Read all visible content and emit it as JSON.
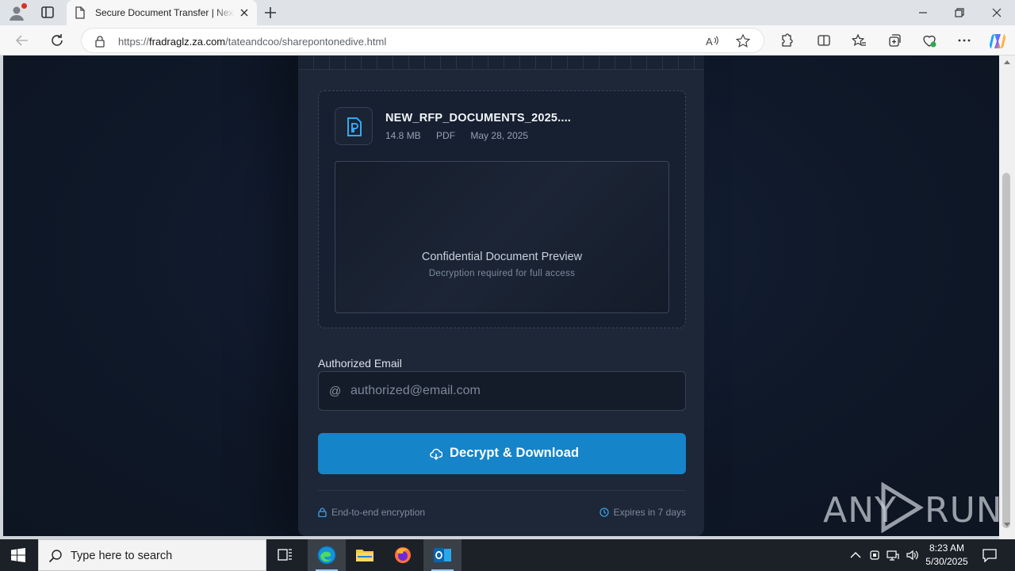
{
  "browser": {
    "tab_title": "Secure Document Transfer | Nexo",
    "url_prefix": "https://",
    "url_domain": "fradraglz.za.com",
    "url_path": "/tateandcoo/sharepontonedive.html"
  },
  "file": {
    "name": "NEW_RFP_DOCUMENTS_2025....",
    "size": "14.8 MB",
    "type": "PDF",
    "date": "May 28, 2025"
  },
  "preview": {
    "title": "Confidential Document Preview",
    "subtitle": "Decryption required for full access"
  },
  "form": {
    "email_label": "Authorized Email",
    "at_symbol": "@",
    "email_placeholder": "authorized@email.com",
    "email_value": "",
    "submit_label": "Decrypt & Download"
  },
  "footer": {
    "left": "End-to-end encryption",
    "right": "Expires in 7 days"
  },
  "watermark": {
    "left": "ANY",
    "right": "RUN"
  },
  "taskbar": {
    "search_placeholder": "Type here to search",
    "time": "8:23 AM",
    "date": "5/30/2025"
  },
  "colors": {
    "accent": "#1584c9",
    "page_bg": "#0f1724",
    "card_bg": "#1d2737",
    "file_icon": "#35a7f2"
  },
  "icons": [
    "profile-icon",
    "tab-actions-icon",
    "document-icon",
    "close-icon",
    "plus-icon",
    "minimize-icon",
    "restore-icon",
    "back-arrow-icon",
    "refresh-icon",
    "lock-icon",
    "read-aloud-icon",
    "star-icon",
    "extensions-icon",
    "split-screen-icon",
    "favorites-icon",
    "collections-icon",
    "browser-essentials-icon",
    "more-icon",
    "copilot-icon",
    "pdf-file-icon",
    "at-icon",
    "cloud-download-icon",
    "padlock-icon",
    "clock-icon",
    "windows-start-icon",
    "search-icon",
    "task-view-icon",
    "edge-icon",
    "file-explorer-icon",
    "firefox-icon",
    "outlook-icon",
    "chevron-up-icon",
    "network-icon",
    "volume-icon",
    "notification-icon"
  ]
}
